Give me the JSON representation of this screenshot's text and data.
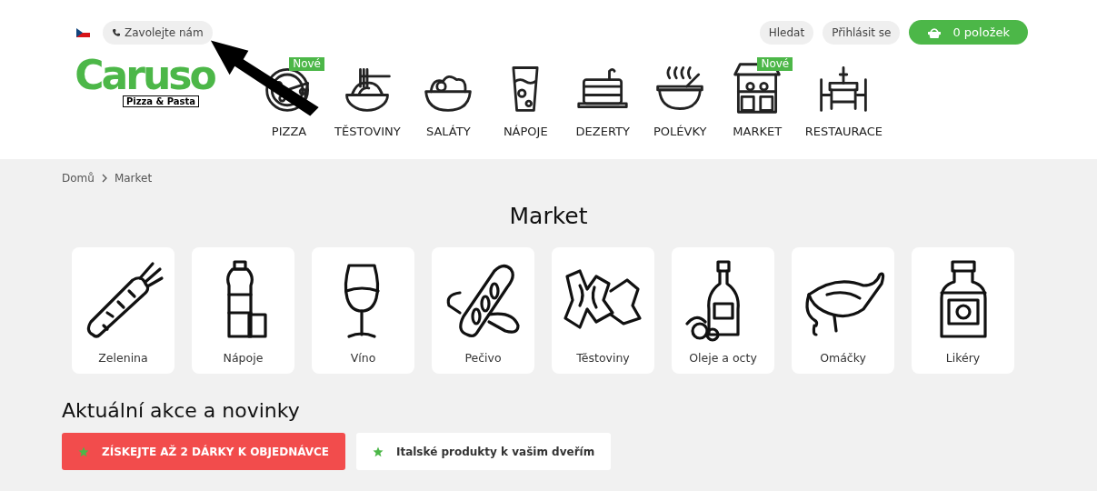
{
  "top_bar": {
    "call_button": "Zavolejte nám",
    "search_button": "Hledat",
    "login_button": "Přihlásit se",
    "cart_button": "0 položek"
  },
  "logo": {
    "name": "Caruso",
    "tagline": "Pizza & Pasta"
  },
  "nav": [
    {
      "label": "PIZZA",
      "badge": "Nové"
    },
    {
      "label": "TĚSTOVINY"
    },
    {
      "label": "SALÁTY"
    },
    {
      "label": "NÁPOJE"
    },
    {
      "label": "DEZERTY"
    },
    {
      "label": "POLÉVKY"
    },
    {
      "label": "MARKET",
      "badge": "Nové"
    },
    {
      "label": "RESTAURACE"
    }
  ],
  "breadcrumb": [
    "Domů",
    "Market"
  ],
  "page_title": "Market",
  "categories": [
    {
      "label": "Zelenina"
    },
    {
      "label": "Nápoje"
    },
    {
      "label": "Víno"
    },
    {
      "label": "Pečivo"
    },
    {
      "label": "Těstoviny"
    },
    {
      "label": "Oleje a octy"
    },
    {
      "label": "Omáčky"
    },
    {
      "label": "Likéry"
    }
  ],
  "promo_heading": "Aktuální akce a novinky",
  "promos": [
    {
      "label": "ZÍSKEJTE AŽ 2 DÁRKY K OBJEDNÁVCE",
      "kind": "highlight"
    },
    {
      "label": "Italské produkty k vašim dveřím",
      "kind": "plain"
    }
  ]
}
